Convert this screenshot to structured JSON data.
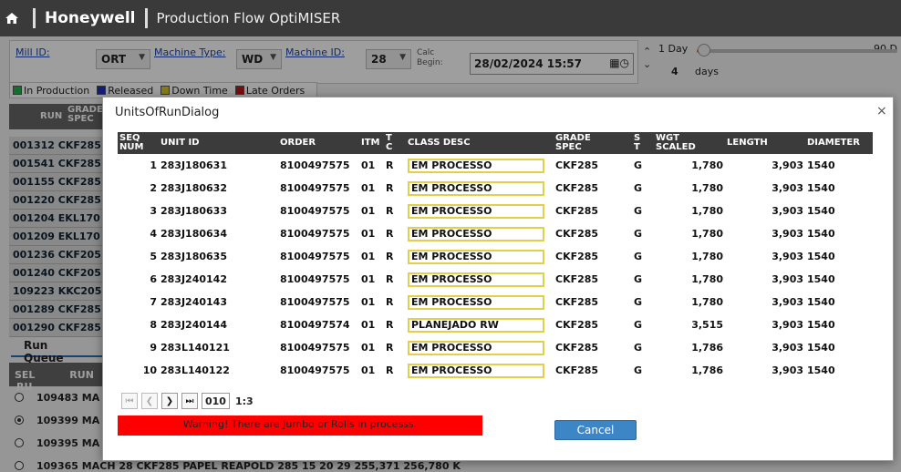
{
  "header": {
    "brand": "Honeywell",
    "app_title": "Production Flow OptiMISER"
  },
  "filters": {
    "mill_label": "Mill ID:",
    "mill_value": "ORT",
    "machine_type_label": "Machine Type:",
    "machine_type_value": "WD",
    "machine_id_label": "Machine ID:",
    "machine_id_value": "28",
    "calc_begin_line1": "Calc",
    "calc_begin_line2": "Begin:",
    "calc_begin_value": "28/02/2024 15:57",
    "range_min": "1 Day",
    "range_max": "90 D",
    "range_value": "4",
    "range_unit": "days",
    "range_fraction": 0.035
  },
  "legend": {
    "items": [
      {
        "label": "In Production",
        "color": "#22b14c"
      },
      {
        "label": "Released",
        "color": "#1f2fbf"
      },
      {
        "label": "Down Time",
        "color": "#d9c72a"
      },
      {
        "label": "Late Orders",
        "color": "#c0141c"
      }
    ]
  },
  "run_grid": {
    "head_run": "RUN",
    "head_grade": "GRADE",
    "head_spec": "SPEC",
    "rows": [
      {
        "run": "001312",
        "grade": "CKF285"
      },
      {
        "run": "001541",
        "grade": "CKF285"
      },
      {
        "run": "001155",
        "grade": "CKF285"
      },
      {
        "run": "001220",
        "grade": "CKF285"
      },
      {
        "run": "001204",
        "grade": "EKL170"
      },
      {
        "run": "001209",
        "grade": "EKL170"
      },
      {
        "run": "001236",
        "grade": "CKF205"
      },
      {
        "run": "001240",
        "grade": "CKF205"
      },
      {
        "run": "109223",
        "grade": "KKC205"
      },
      {
        "run": "001289",
        "grade": "CKF285"
      },
      {
        "run": "001290",
        "grade": "CKF285"
      }
    ]
  },
  "run_queue": {
    "tab_label": "Run Queue",
    "head_sel": "SEL",
    "head_run": "RUN",
    "head_ru": "RU",
    "rows": [
      {
        "run": "109483",
        "desc": "MA",
        "selected": false
      },
      {
        "run": "109399",
        "desc": "MA",
        "selected": true
      },
      {
        "run": "109395",
        "desc": "MA",
        "selected": false
      },
      {
        "run": "109365",
        "desc": "MACH 28 CKF285 PAPEL REAPOLD 285   15   20   29   255,371   256,780  K",
        "selected": false
      }
    ]
  },
  "dialog": {
    "title": "UnitsOfRunDialog",
    "close_label": "×",
    "columns": {
      "seq": [
        "SEQ",
        "NUM"
      ],
      "unit_id": "UNIT ID",
      "order": "ORDER",
      "itm": "ITM",
      "tc": [
        "T",
        "C"
      ],
      "class_desc": "CLASS DESC",
      "grade_spec": [
        "GRADE",
        "SPEC"
      ],
      "st": [
        "S",
        "T"
      ],
      "wgt": [
        "WGT",
        "SCALED"
      ],
      "length": "LENGTH",
      "diameter": "DIAMETER"
    },
    "rows": [
      {
        "seq": "1",
        "unit_id": "283J180631",
        "order": "8100497575",
        "itm": "01",
        "tc": "R",
        "class_desc": "EM PROCESSO",
        "grade_spec": "CKF285",
        "st": "G",
        "wgt": "1,780",
        "length": "3,903",
        "diameter": "1540"
      },
      {
        "seq": "2",
        "unit_id": "283J180632",
        "order": "8100497575",
        "itm": "01",
        "tc": "R",
        "class_desc": "EM PROCESSO",
        "grade_spec": "CKF285",
        "st": "G",
        "wgt": "1,780",
        "length": "3,903",
        "diameter": "1540"
      },
      {
        "seq": "3",
        "unit_id": "283J180633",
        "order": "8100497575",
        "itm": "01",
        "tc": "R",
        "class_desc": "EM PROCESSO",
        "grade_spec": "CKF285",
        "st": "G",
        "wgt": "1,780",
        "length": "3,903",
        "diameter": "1540"
      },
      {
        "seq": "4",
        "unit_id": "283J180634",
        "order": "8100497575",
        "itm": "01",
        "tc": "R",
        "class_desc": "EM PROCESSO",
        "grade_spec": "CKF285",
        "st": "G",
        "wgt": "1,780",
        "length": "3,903",
        "diameter": "1540"
      },
      {
        "seq": "5",
        "unit_id": "283J180635",
        "order": "8100497575",
        "itm": "01",
        "tc": "R",
        "class_desc": "EM PROCESSO",
        "grade_spec": "CKF285",
        "st": "G",
        "wgt": "1,780",
        "length": "3,903",
        "diameter": "1540"
      },
      {
        "seq": "6",
        "unit_id": "283J240142",
        "order": "8100497575",
        "itm": "01",
        "tc": "R",
        "class_desc": "EM PROCESSO",
        "grade_spec": "CKF285",
        "st": "G",
        "wgt": "1,780",
        "length": "3,903",
        "diameter": "1540"
      },
      {
        "seq": "7",
        "unit_id": "283J240143",
        "order": "8100497575",
        "itm": "01",
        "tc": "R",
        "class_desc": "EM PROCESSO",
        "grade_spec": "CKF285",
        "st": "G",
        "wgt": "1,780",
        "length": "3,903",
        "diameter": "1540"
      },
      {
        "seq": "8",
        "unit_id": "283J240144",
        "order": "8100497574",
        "itm": "01",
        "tc": "R",
        "class_desc": "PLANEJADO RW",
        "grade_spec": "CKF285",
        "st": "G",
        "wgt": "3,515",
        "length": "3,903",
        "diameter": "1540"
      },
      {
        "seq": "9",
        "unit_id": "283L140121",
        "order": "8100497575",
        "itm": "01",
        "tc": "R",
        "class_desc": "EM PROCESSO",
        "grade_spec": "CKF285",
        "st": "G",
        "wgt": "1,786",
        "length": "3,903",
        "diameter": "1540"
      },
      {
        "seq": "10",
        "unit_id": "283L140122",
        "order": "8100497575",
        "itm": "01",
        "tc": "R",
        "class_desc": "EM PROCESSO",
        "grade_spec": "CKF285",
        "st": "G",
        "wgt": "1,786",
        "length": "3,903",
        "diameter": "1540"
      }
    ],
    "pager": {
      "page_box": "010",
      "page_info": "1:3"
    },
    "warning": "Warning! There are Jumbo or Rolls in processs.",
    "cancel_label": "Cancel"
  }
}
